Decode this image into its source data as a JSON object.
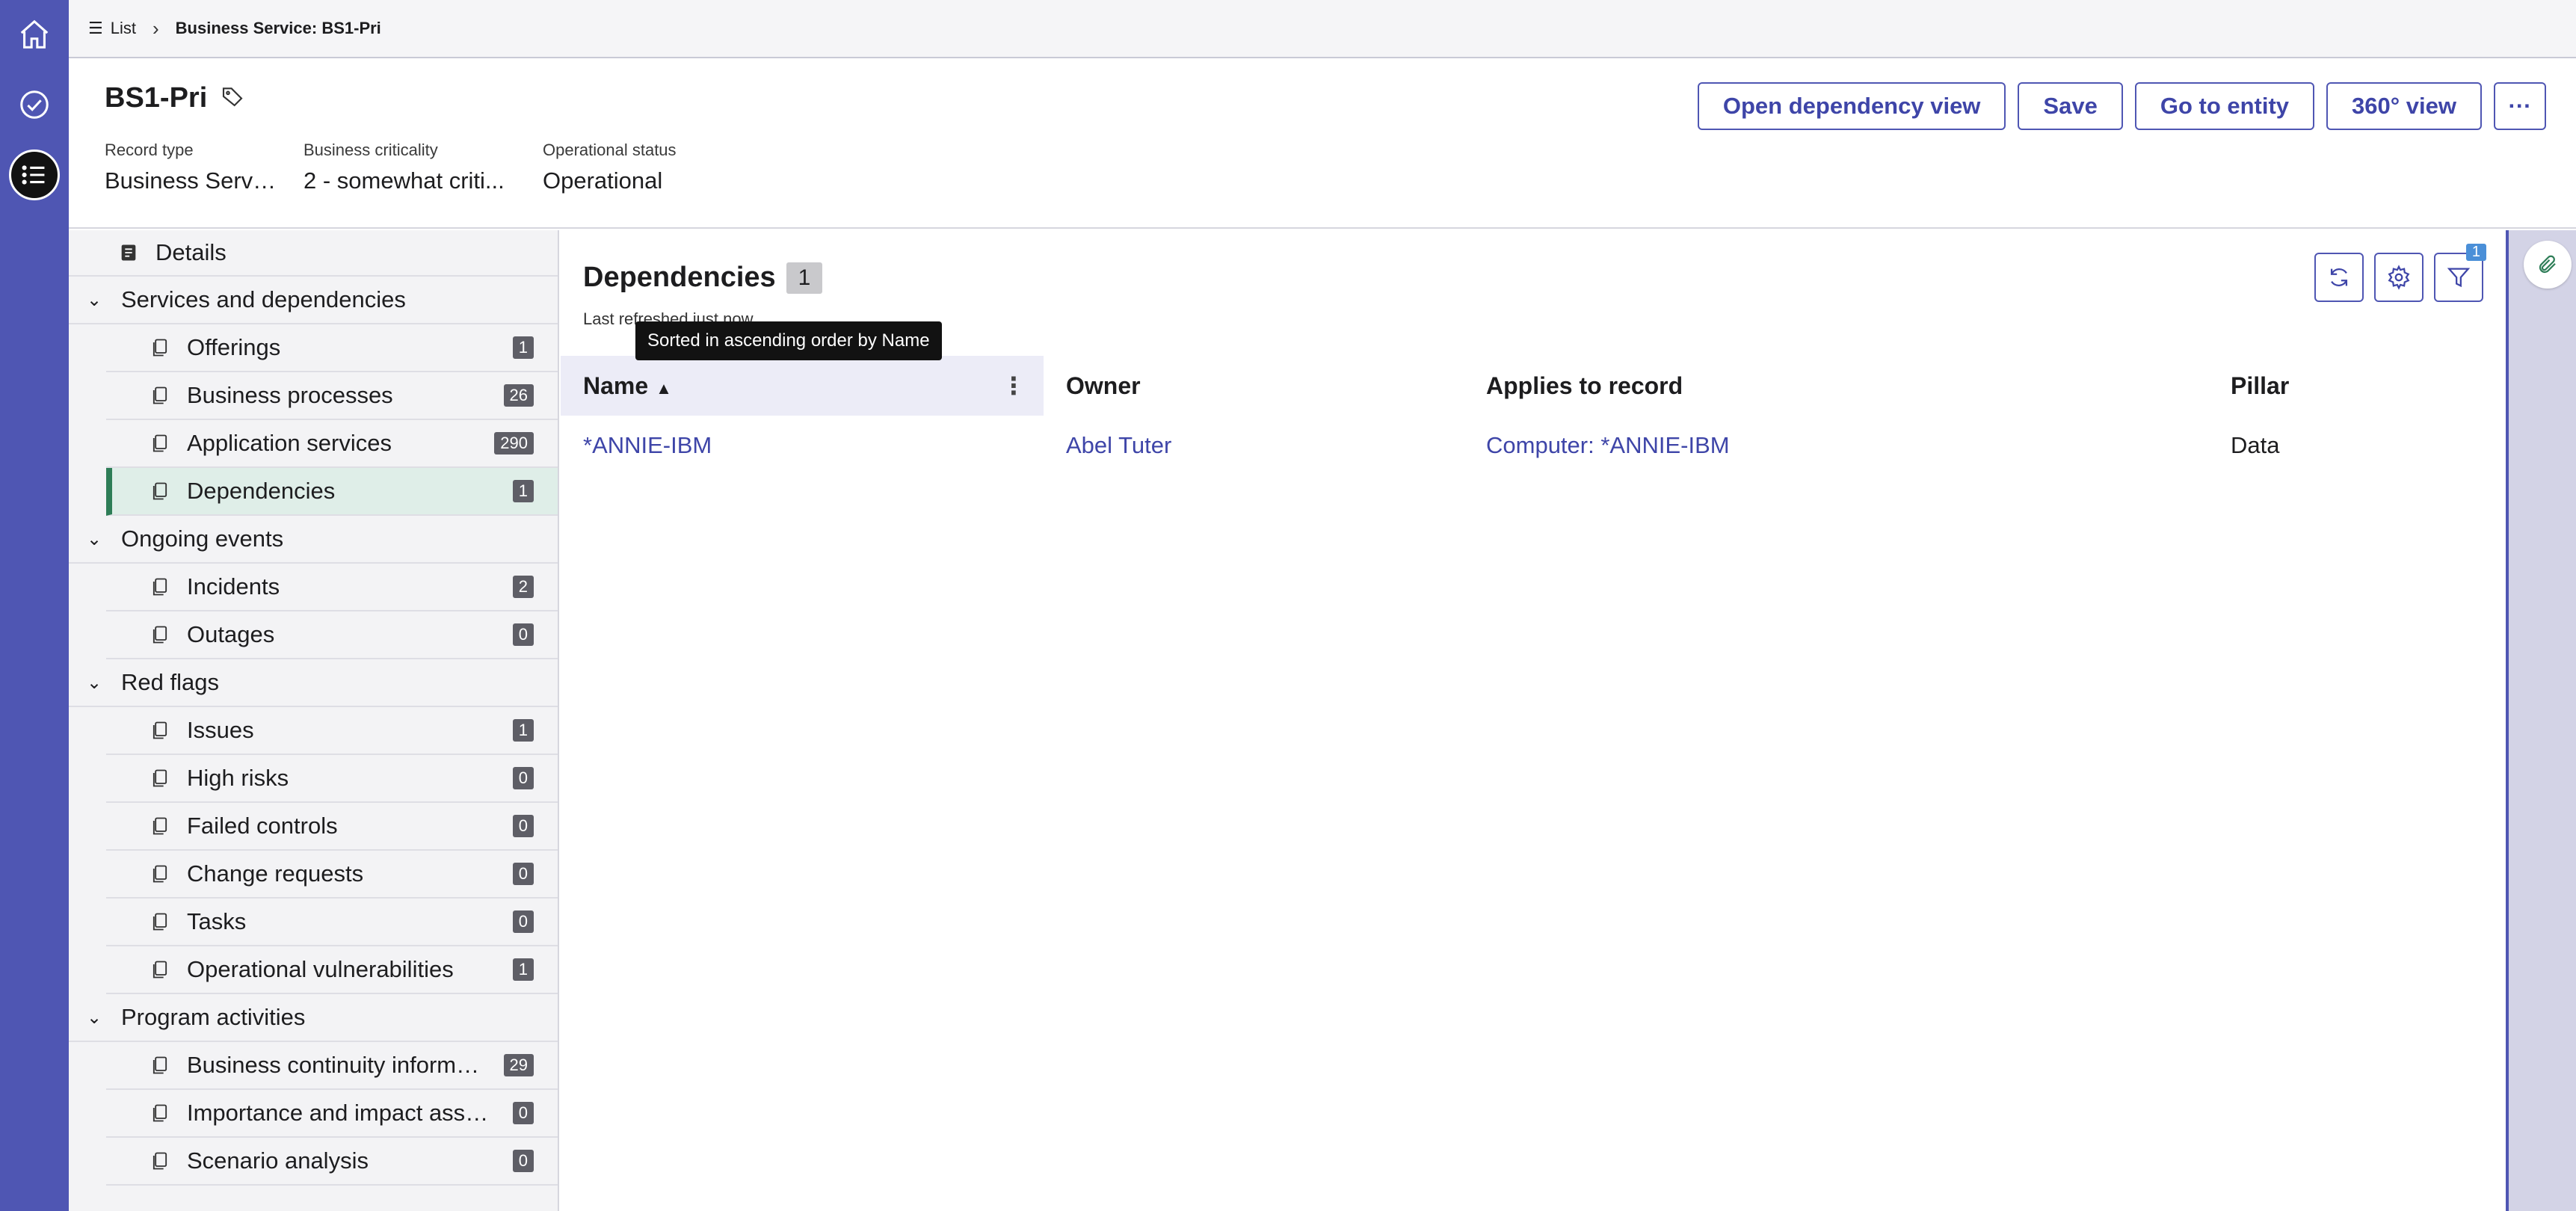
{
  "rail": {
    "icons": [
      "home-icon",
      "check-circle-icon",
      "list-icon"
    ]
  },
  "breadcrumb": {
    "list_label": "List",
    "current": "Business Service: BS1-Pri"
  },
  "header": {
    "title": "BS1-Pri",
    "fields": [
      {
        "label": "Record type",
        "value": "Business Service"
      },
      {
        "label": "Business criticality",
        "value": "2 - somewhat criti..."
      },
      {
        "label": "Operational status",
        "value": "Operational"
      }
    ],
    "actions": {
      "open_dependency_view": "Open dependency view",
      "save": "Save",
      "go_to_entity": "Go to entity",
      "view_360": "360° view",
      "more": "···"
    }
  },
  "sidenav": {
    "details": "Details",
    "groups": [
      {
        "label": "Services and dependencies",
        "items": [
          {
            "label": "Offerings",
            "count": "1"
          },
          {
            "label": "Business processes",
            "count": "26"
          },
          {
            "label": "Application services",
            "count": "290"
          },
          {
            "label": "Dependencies",
            "count": "1",
            "active": true
          }
        ]
      },
      {
        "label": "Ongoing events",
        "items": [
          {
            "label": "Incidents",
            "count": "2"
          },
          {
            "label": "Outages",
            "count": "0"
          }
        ]
      },
      {
        "label": "Red flags",
        "items": [
          {
            "label": "Issues",
            "count": "1"
          },
          {
            "label": "High risks",
            "count": "0"
          },
          {
            "label": "Failed controls",
            "count": "0"
          },
          {
            "label": "Change requests",
            "count": "0"
          },
          {
            "label": "Tasks",
            "count": "0"
          },
          {
            "label": "Operational vulnerabilities",
            "count": "1"
          }
        ]
      },
      {
        "label": "Program activities",
        "items": [
          {
            "label": "Business continuity informa...",
            "count": "29"
          },
          {
            "label": "Importance and impact asse...",
            "count": "0"
          },
          {
            "label": "Scenario analysis",
            "count": "0"
          }
        ]
      }
    ]
  },
  "main": {
    "title": "Dependencies",
    "count": "1",
    "refreshed": "Last refreshed just now",
    "tooltip": "Sorted in ascending order by Name",
    "filter_count": "1",
    "columns": [
      "Name",
      "Owner",
      "Applies to record",
      "Pillar"
    ],
    "rows": [
      {
        "name": "*ANNIE-IBM",
        "owner": "Abel Tuter",
        "applies_to": "Computer: *ANNIE-IBM",
        "pillar": "Data"
      }
    ]
  },
  "colors": {
    "rail": "#4f56b3",
    "accent": "#3e45a8",
    "active_nav": "#dfeee8",
    "active_border": "#2e7d57"
  }
}
